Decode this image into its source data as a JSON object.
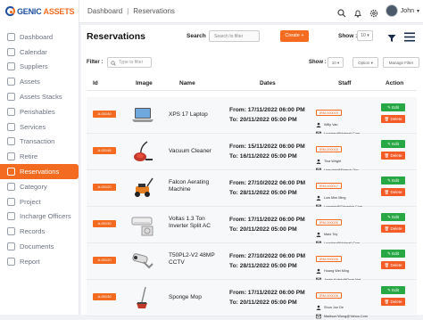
{
  "brand": {
    "logo_part1": "GENIC",
    "logo_part2": "ASSETS"
  },
  "sidebar": {
    "items": [
      {
        "label": "Dashboard",
        "icon": "dashboard-icon",
        "active": false
      },
      {
        "label": "Calendar",
        "icon": "calendar-icon",
        "active": false
      },
      {
        "label": "Suppliers",
        "icon": "suppliers-icon",
        "active": false
      },
      {
        "label": "Assets",
        "icon": "assets-icon",
        "active": false
      },
      {
        "label": "Assets Stacks",
        "icon": "stack-icon",
        "active": false
      },
      {
        "label": "Perishables",
        "icon": "perishables-icon",
        "active": false
      },
      {
        "label": "Services",
        "icon": "services-icon",
        "active": false
      },
      {
        "label": "Transaction",
        "icon": "transaction-icon",
        "active": false
      },
      {
        "label": "Retire",
        "icon": "retire-icon",
        "active": false
      },
      {
        "label": "Reservations",
        "icon": "reservations-icon",
        "active": true
      },
      {
        "label": "Category",
        "icon": "category-icon",
        "active": false
      },
      {
        "label": "Project",
        "icon": "project-icon",
        "active": false
      },
      {
        "label": "Incharge Officers",
        "icon": "officers-icon",
        "active": false
      },
      {
        "label": "Records",
        "icon": "records-icon",
        "active": false
      },
      {
        "label": "Documents",
        "icon": "documents-icon",
        "active": false
      },
      {
        "label": "Report",
        "icon": "report-icon",
        "active": false
      }
    ]
  },
  "topbar": {
    "crumb1": "Dashboard",
    "crumb2": "Reservations",
    "user_name": "John"
  },
  "main": {
    "title": "Reservations",
    "search_label": "Search",
    "search_placeholder": "Search to filter",
    "create_label": "Create",
    "show_label": "Show :",
    "show_value": "10",
    "filter_label": "Filter :",
    "filter_placeholder": "Type to filter",
    "show2_label": "Show :",
    "show2_value": "10",
    "options_label": "Option",
    "manage_label": "Manage Filter",
    "columns": {
      "id": "Id",
      "image": "Image",
      "name": "Name",
      "dates": "Dates",
      "staff": "Staff",
      "action": "Action"
    },
    "edit_label": "Edit",
    "delete_label": "Delete",
    "rows": [
      {
        "id": "A-00140",
        "name": "XPS 17 Laptop",
        "from": "From: 17/11/2022 06:00 PM",
        "to": "To: 20/11/2022 05:00 PM",
        "staff_id": "IRM-000019",
        "staff_name": "Willy Van",
        "staff_email": "Loonkey@Hotmail.Com",
        "image": "laptop"
      },
      {
        "id": "A-00146",
        "name": "Vacuum Cleaner",
        "from": "From: 15/11/2022 06:00 PM",
        "to": "To: 16/11/2022 05:00 PM",
        "staff_id": "IRM-000018",
        "staff_name": "Tina Wright",
        "staff_email": "Learnlab@Fintech.Org",
        "image": "vacuum"
      },
      {
        "id": "A-00120",
        "name": "Falcon Aerating Machine",
        "from": "From: 27/10/2022 06:00 PM",
        "to": "To: 28/11/2022 05:00 PM",
        "staff_id": "IRM-000017",
        "staff_name": "Low Mim Ming",
        "staff_email": "Lowmim@Gdyanish.Com",
        "image": "mower"
      },
      {
        "id": "A-00130",
        "name": "Voltas 1.3 Ton Inverter Split AC",
        "from": "From: 17/11/2022 06:00 PM",
        "to": "To: 20/11/2022 05:00 PM",
        "staff_id": "IRM-000026",
        "staff_name": "Mark Tey",
        "staff_email": "Loonkey@Hotmail.Com",
        "image": "ac"
      },
      {
        "id": "A-00120",
        "name": "T50PL2-V2 48MP CCTV",
        "from": "From: 27/10/2022 06:00 PM",
        "to": "To: 28/11/2022 05:00 PM",
        "staff_id": "IRM-000026",
        "staff_name": "Hoang Wei Ming",
        "staff_email": "Justin.Kotich@Dyyb.Net",
        "image": "cctv"
      },
      {
        "id": "A-00130",
        "name": "Sponge Mop",
        "from": "From: 17/11/2022 06:00 PM",
        "to": "To: 20/11/2022 05:00 PM",
        "staff_id": "IRM-000026",
        "staff_name": "Shun Jun De",
        "staff_email": "Madison.Wong@Yahoo.Com",
        "image": "mop"
      }
    ]
  },
  "colors": {
    "accent": "#f26b21",
    "edit": "#27a844",
    "delete": "#f35b27",
    "brand_blue": "#1e4fa0"
  }
}
